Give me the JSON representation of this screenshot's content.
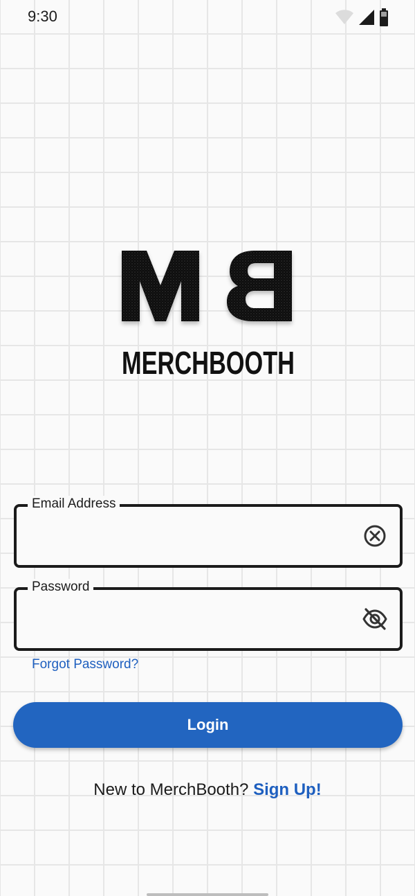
{
  "status_bar": {
    "time": "9:30",
    "icons": [
      "wifi-icon",
      "cell-signal-icon",
      "battery-icon"
    ]
  },
  "logo": {
    "monogram": "MB",
    "wordmark": "MERCHBOOTH"
  },
  "email_field": {
    "label": "Email Address",
    "value": "",
    "placeholder": "",
    "trailing_icon": "clear-circle-icon"
  },
  "password_field": {
    "label": "Password",
    "value": "",
    "placeholder": "",
    "trailing_icon": "visibility-off-icon"
  },
  "forgot_password": "Forgot Password?",
  "login_button": "Login",
  "signup": {
    "prompt": "New to MerchBooth?",
    "link": "Sign Up!"
  },
  "colors": {
    "accent": "#2265c0",
    "link": "#1e5fbf",
    "text": "#1b1b1b",
    "background": "#fafafa",
    "grid": "#e6e6e6"
  }
}
